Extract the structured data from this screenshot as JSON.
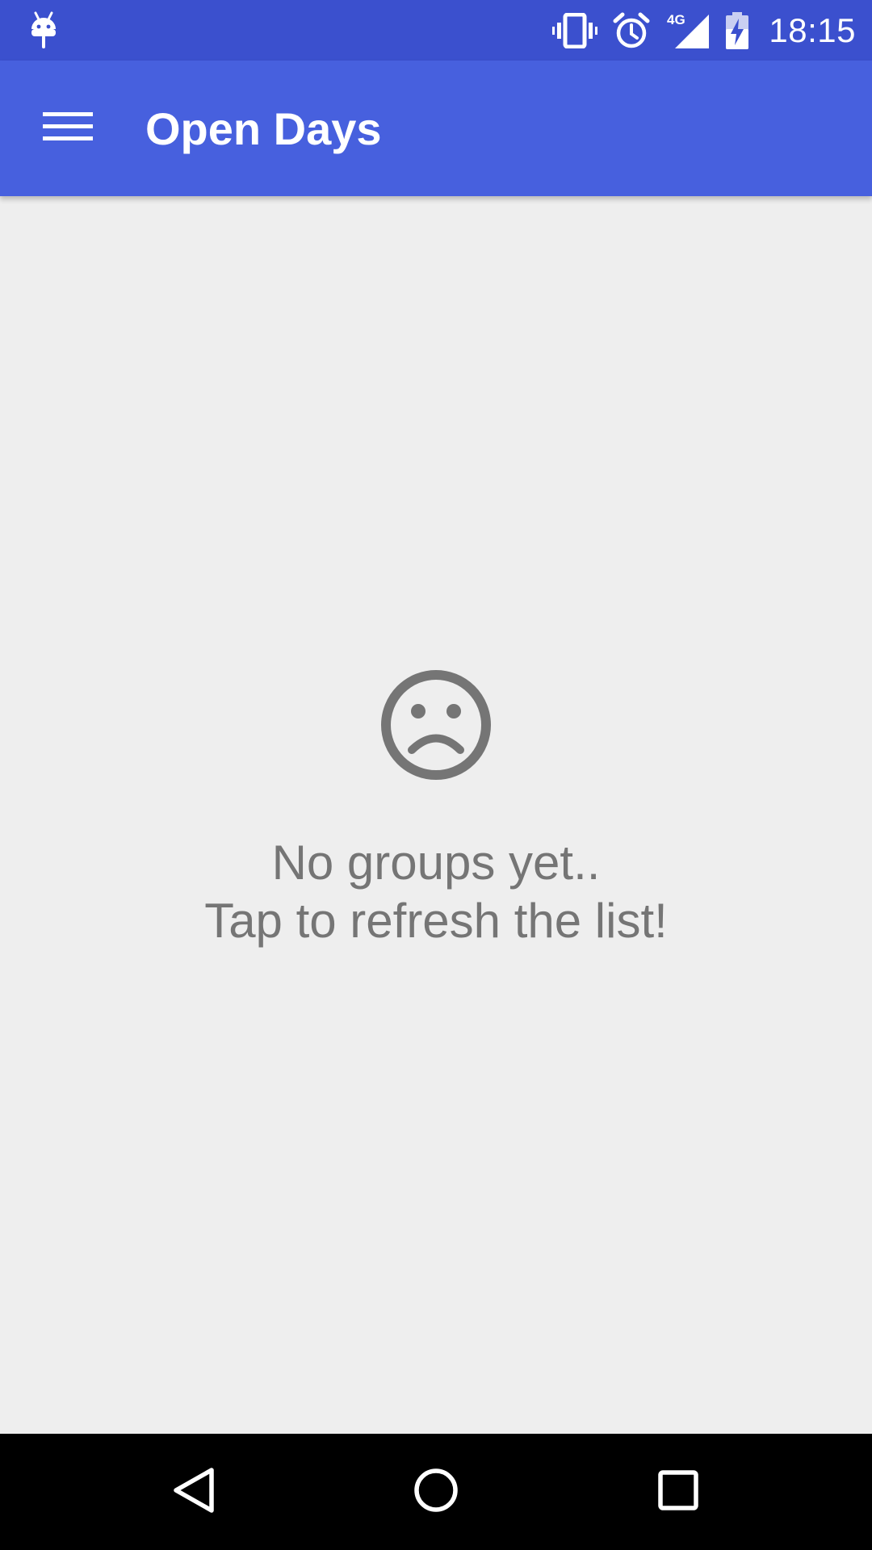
{
  "status_bar": {
    "time": "18:15",
    "network_label": "4G",
    "icons": [
      "debug-icon",
      "vibrate-icon",
      "alarm-icon",
      "signal-icon",
      "battery-charging-icon"
    ]
  },
  "app_bar": {
    "title": "Open Days",
    "menu_icon": "hamburger-menu-icon",
    "background_color": "#4760de"
  },
  "empty_state": {
    "icon": "sad-face-icon",
    "line1": "No groups yet..",
    "line2": "Tap to refresh the list!",
    "text_color": "#757575"
  },
  "nav_bar": {
    "buttons": [
      "back",
      "home",
      "recents"
    ]
  },
  "colors": {
    "status_bar": "#3b50ce",
    "app_bar": "#4760de",
    "background": "#eeeeee",
    "nav_bar": "#000000"
  }
}
